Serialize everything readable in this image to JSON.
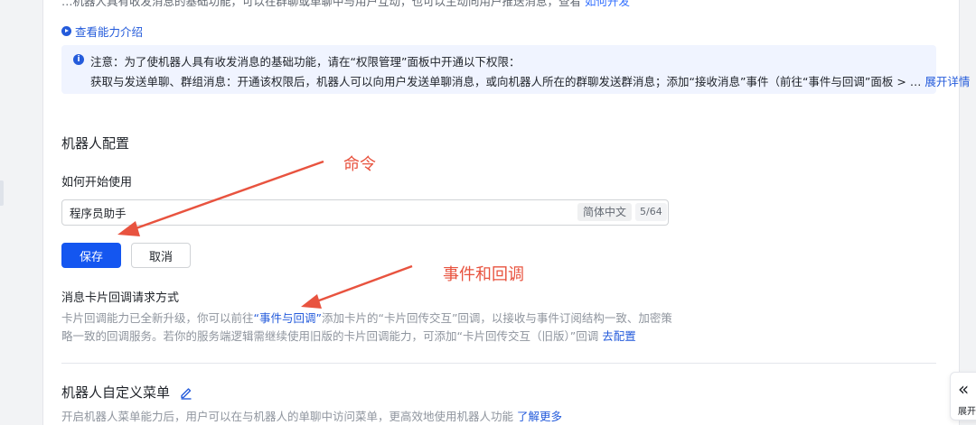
{
  "top_partial": {
    "text": "…机器人具有收发消息的基础功能，可以在群聊或单聊中与用户互动，也可以主动向用户推送消息，查看 ",
    "link": "如何开发"
  },
  "capability_link": "查看能力介绍",
  "notice": {
    "line1": "注意：为了使机器人具有收发消息的基础功能，请在“权限管理”面板中开通以下权限：",
    "line2": "获取与发送单聊、群组消息：开通该权限后，机器人可以向用户发送单聊消息，或向机器人所在的群聊发送群消息；添加“接收消息”事件（前往“事件与回调”面板 > …",
    "expand_label": "展开详情"
  },
  "robot_config": {
    "title": "机器人配置",
    "how_to_start": "如何开始使用",
    "input_value": "程序员助手",
    "lang": "简体中文",
    "counter": "5/64",
    "save_label": "保存",
    "cancel_label": "取消"
  },
  "card_callback": {
    "title": "消息卡片回调请求方式",
    "desc_part1": "卡片回调能力已全新升级，你可以前往",
    "desc_link1": "“事件与回调”",
    "desc_part2": "添加卡片的“卡片回传交互”回调，以接收与事件订阅结构一致、加密策略一致的回调服务。若你的服务端逻辑需继续使用旧版的卡片回调能力，可添加“卡片回传交互（旧版）”回调 ",
    "desc_link2": "去配置"
  },
  "custom_menu": {
    "title": "机器人自定义菜单",
    "desc": "开启机器人菜单能力后，用户可以在与机器人的单聊中访问菜单，更高效地使用机器人功能 ",
    "link": "了解更多"
  },
  "annotations": {
    "command": "命令",
    "events": "事件和回调"
  },
  "side_panel": {
    "icon": "double-chevron-left-icon",
    "label": "展开"
  },
  "colors": {
    "primary": "#1456f0",
    "link": "#245bdb",
    "annotation": "#e8533f",
    "notice_bg": "#f0f4ff"
  }
}
